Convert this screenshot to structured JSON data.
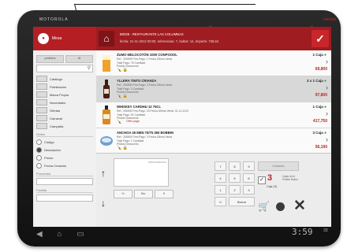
{
  "device": {
    "brand": "MOTOROLA",
    "carrier": "verizon",
    "clock": "3:59",
    "clock_suffix": "33"
  },
  "left_panel": {
    "user": "Mesa",
    "tabs": [
      "pedidos",
      "Al"
    ],
    "search_placeholder": "",
    "filters": [
      "Catálogo",
      "Fidelización",
      "Marca Propia",
      "Novedades",
      "Ofertas",
      "Carnaval",
      "Campaña"
    ],
    "order_header": "Orden",
    "order_options": [
      {
        "label": "Código",
        "selected": false
      },
      {
        "label": "Descripción",
        "selected": true
      },
      {
        "label": "Precio",
        "selected": false
      },
      {
        "label": "Fecha Creación",
        "selected": false
      }
    ],
    "field_labels": [
      "Proveedor",
      "Familia"
    ]
  },
  "top_bar": {
    "title": "B0026 - RESTAURANTE LAS COLUMNAS",
    "info": "fecha: 21-11-2012 00:00, referencias: 7, bultos: 14, Importe: 738,64"
  },
  "products": [
    {
      "name": "ZUMO MELOCOTÓN 1000 CONPOOOL",
      "meta1": "Ref.: 206908   Prev.Pago: 1   Fecha Última Venta",
      "meta2": "Total Pago: 76   Cantidad",
      "meta3": "Pedido   Descuento",
      "qty": "1 Caja",
      "price": "69,800",
      "extra": "",
      "selected": false
    },
    {
      "name": "YLLERA TINTO CRIANZA",
      "meta1": "Ref.: 206906   Prev.Pago: 3   Fecha Última Venta",
      "meta2": "Total Pago: 3   Cantidad",
      "meta3": "Pedido   Descuento",
      "qty": "3 x 1 Caja",
      "price": "97,800",
      "extra": "",
      "selected": true
    },
    {
      "name": "WHISKEY CARDHU 12 75CL",
      "meta1": "Ref.: 206905   Prev.Pago: 25   Fecha Última Venta: 01-11-2012",
      "meta2": "Total Pago: 51   Cantidad",
      "meta3": "Pedido   Descuento",
      "qty": "1 Caja",
      "price": "417,750",
      "extra": "Offer page",
      "selected": false
    },
    {
      "name": "ANCHOA 45 MEN 70/75 350 BOBBIN",
      "meta1": "Ref.: 206904   Prev.Pago: 3   Fecha Última Venta",
      "meta2": "Total Pago: 1   Cantidad",
      "meta3": "Pedido   Descuento",
      "qty": "3 Caja",
      "price": "56,190",
      "extra": "",
      "selected": false
    }
  ],
  "controls": {
    "notes_placeholder": "observaciones",
    "discount_buttons": [
      "%",
      "Dto.",
      "€"
    ],
    "keypad": [
      "7",
      "8",
      "9",
      "4",
      "5",
      "6",
      "1",
      "2",
      "3",
      "0",
      "Borrar"
    ],
    "price_box": "Unidades",
    "boxes_count": "3",
    "boxes_label": "Caja (S)",
    "boxes_side": "Cajas Unid. Pedido Bultos"
  }
}
